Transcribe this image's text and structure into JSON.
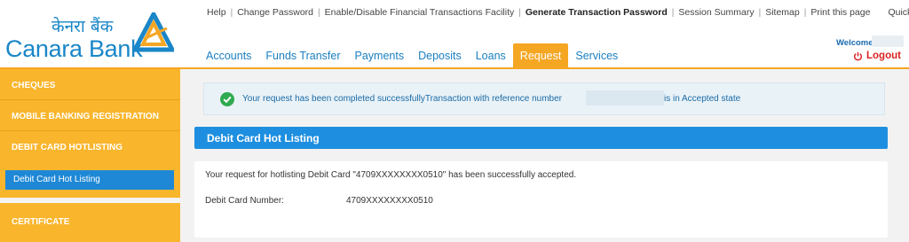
{
  "logo": {
    "hindi": "केनरा बैंक",
    "english": "Canara Bank"
  },
  "top_links": [
    {
      "label": "Help",
      "bold": false
    },
    {
      "label": "Change Password",
      "bold": false
    },
    {
      "label": "Enable/Disable Financial Transactions Facility",
      "bold": false
    },
    {
      "label": "Generate Transaction Password",
      "bold": true
    },
    {
      "label": "Session Summary",
      "bold": false
    },
    {
      "label": "Sitemap",
      "bold": false
    },
    {
      "label": "Print this page",
      "bold": false
    }
  ],
  "quick_links": "Quick Links »",
  "nav": {
    "tabs": [
      "Accounts",
      "Funds Transfer",
      "Payments",
      "Deposits",
      "Loans",
      "Request",
      "Services"
    ],
    "active": "Request"
  },
  "welcome": "Welcome",
  "logout": "Logout",
  "sidebar": {
    "items": [
      "CHEQUES",
      "MOBILE BANKING REGISTRATION",
      "DEBIT CARD HOTLISTING"
    ],
    "active_item": "Debit Card Hot Listing",
    "items_after": [
      "CERTIFICATE"
    ]
  },
  "alert": {
    "text": "Your request has been completed successfullyTransaction with reference number",
    "tail": "is in Accepted state"
  },
  "panel": {
    "title": "Debit Card Hot Listing",
    "message": "Your request for hotlisting Debit Card \"4709XXXXXXXX0510\" has been successfully accepted.",
    "field_label": "Debit Card Number:",
    "field_value": "4709XXXXXXXX0510"
  },
  "colors": {
    "brand_blue": "#1a86c8",
    "accent_orange": "#f9b52c",
    "active_blue": "#1e88d6",
    "logout_red": "#d92222"
  }
}
